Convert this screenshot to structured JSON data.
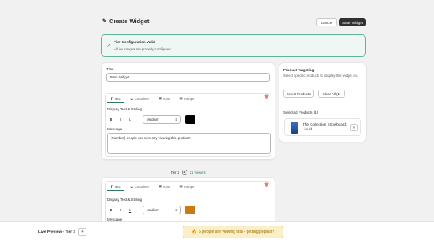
{
  "header": {
    "title": "Create Widget",
    "cancel_label": "Cancel",
    "save_label": "Save Widget"
  },
  "banner": {
    "title": "Tier Configuration Valid",
    "text": "All tier ranges are properly configured"
  },
  "form": {
    "title_label": "Title",
    "title_value": "Main Widget"
  },
  "tabs": [
    {
      "label": "Text",
      "icon": "text-icon"
    },
    {
      "label": "Container",
      "icon": "container-icon"
    },
    {
      "label": "Icon",
      "icon": "image-icon"
    },
    {
      "label": "Range",
      "icon": "eye-icon"
    }
  ],
  "tier1": {
    "styling_label": "Display Text & Styling",
    "bold": "B",
    "italic": "I",
    "underline": "U",
    "size_value": "Medium",
    "color": "#000000",
    "message_label": "Message",
    "message_value": "{Number} people are currently viewing this product!"
  },
  "tier_divider": {
    "label": "Tier 2",
    "viewers": "21 viewers"
  },
  "tier2": {
    "styling_label": "Display Text & Styling",
    "bold": "B",
    "italic": "I",
    "underline": "U",
    "size_value": "Medium",
    "color": "#c97a10",
    "message_label": "Message"
  },
  "targeting": {
    "title": "Product Targeting",
    "description": "Select specific products to display this widget on.",
    "select_label": "Select Products",
    "clear_label": "Clear All (1)",
    "selected_title": "Selected Products (1)",
    "product_name": "The Collection Snowboard: Liquid",
    "remove_label": "×"
  },
  "footer": {
    "live_label": "Live Preview - Tier 2",
    "preview_icon": "🔥",
    "preview_text": "5 people are viewing this - getting popular!"
  },
  "colors": {
    "accent": "#2a7d63",
    "primary_button": "#303030",
    "banner_bg": "#eef7f3",
    "preview_bg": "#fbefc8"
  }
}
